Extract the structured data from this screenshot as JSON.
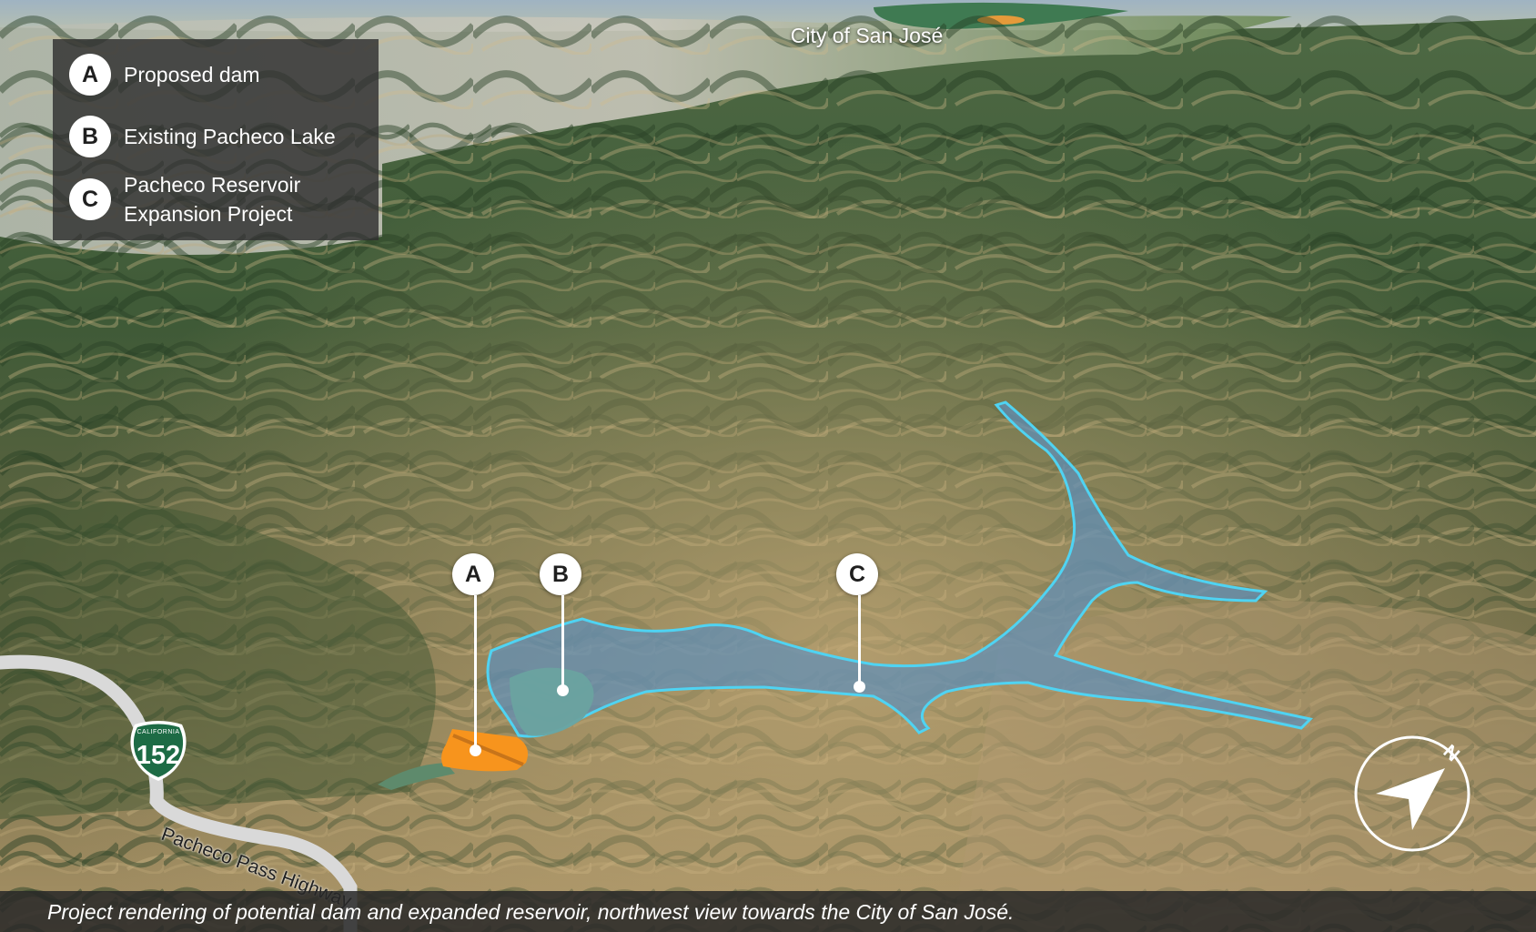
{
  "legend": {
    "items": [
      {
        "letter": "A",
        "label": "Proposed dam"
      },
      {
        "letter": "B",
        "label": "Existing Pacheco Lake"
      },
      {
        "letter": "C",
        "label": "Pacheco Reservoir Expansion Project"
      }
    ]
  },
  "map_labels": {
    "city": "City of San José",
    "highway_name": "Pacheco Pass Highway",
    "highway_shield_state": "CALIFORNIA",
    "highway_shield_number": "152"
  },
  "markers": [
    {
      "letter": "A"
    },
    {
      "letter": "B"
    },
    {
      "letter": "C"
    }
  ],
  "compass": {
    "north_label": "N"
  },
  "caption": "Project rendering of potential dam and expanded reservoir, northwest view towards the City of San José.",
  "colors": {
    "dam": "#f7941d",
    "existing_lake": "#6aa3a0",
    "expansion_water": "#5f8fb8",
    "expansion_outline": "#4fd3f2",
    "highway": "#d9d9d9",
    "shield": "#1d6b45"
  }
}
